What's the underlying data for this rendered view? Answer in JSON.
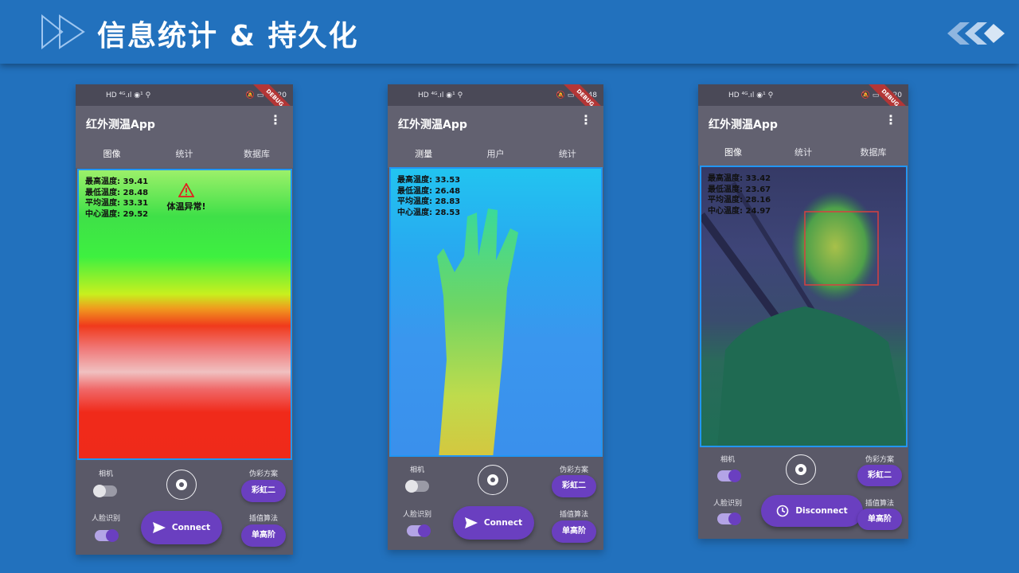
{
  "slide": {
    "title": "信息统计 & 持久化"
  },
  "phones": [
    {
      "status_left": "HD ⁴ᴳ.ıl ◉¹ ⚲",
      "status_right": "🔕 ▭ 03:20",
      "debug": "DEBUG",
      "app_title": "红外测温App",
      "tabs": [
        "图像",
        "统计",
        "数据库"
      ],
      "active_tab": 0,
      "stats": [
        "最高温度: 39.41",
        "最低温度: 28.48",
        "平均温度: 33.31",
        "中心温度: 29.52"
      ],
      "warning": "体温异常!",
      "camera_label": "相机",
      "face_label": "人脸识别",
      "palette_label": "伪彩方案",
      "palette_value": "彩虹二",
      "interp_label": "插值算法",
      "interp_value": "单高阶",
      "connect_label": "Connect",
      "camera_on": false,
      "face_on": true
    },
    {
      "status_left": "HD ⁴ᴳ.ıl ◉¹ ⚲",
      "status_right": "🔕 ▭ 00:48",
      "debug": "DEBUG",
      "app_title": "红外测温App",
      "tabs": [
        "测量",
        "用户",
        "统计"
      ],
      "active_tab": 0,
      "stats": [
        "最高温度: 33.53",
        "最低温度: 26.48",
        "平均温度: 28.83",
        "中心温度: 28.53"
      ],
      "camera_label": "相机",
      "face_label": "人脸识别",
      "palette_label": "伪彩方案",
      "palette_value": "彩虹二",
      "interp_label": "插值算法",
      "interp_value": "单高阶",
      "connect_label": "Connect",
      "camera_on": false,
      "face_on": true
    },
    {
      "status_left": "HD ⁴ᴳ.ıl ◉¹ ⚲",
      "status_right": "🔕 ▭ 01:20",
      "debug": "DEBUG",
      "app_title": "红外测温App",
      "tabs": [
        "图像",
        "统计",
        "数据库"
      ],
      "active_tab": 0,
      "stats": [
        "最高温度: 33.42",
        "最低温度: 23.67",
        "平均温度: 28.16",
        "中心温度: 24.97"
      ],
      "camera_label": "相机",
      "face_label": "人脸识别",
      "palette_label": "伪彩方案",
      "palette_value": "彩虹二",
      "interp_label": "插值算法",
      "interp_value": "单高阶",
      "connect_label": "Disconnect",
      "camera_on": true,
      "face_on": true
    }
  ],
  "colors": {
    "background": "#2271bd",
    "accent": "#6a3fc0",
    "appbar": "#626170",
    "border": "#2196f3"
  }
}
